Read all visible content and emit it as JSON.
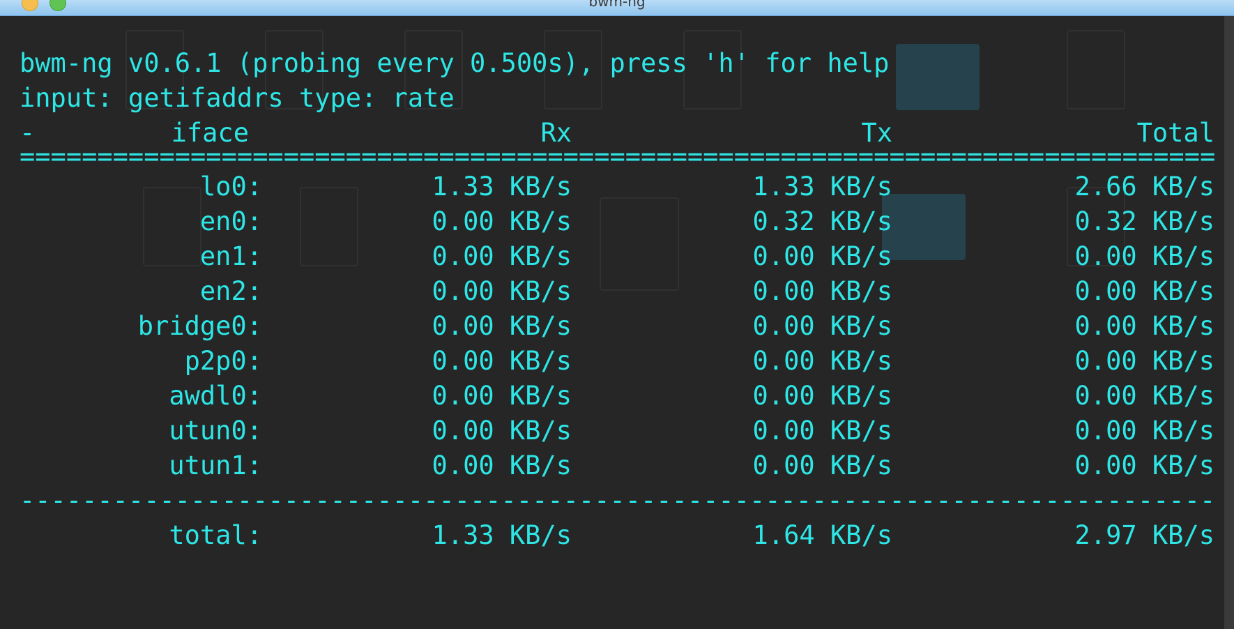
{
  "window": {
    "title": "bwm-ng"
  },
  "terminal": {
    "header_line": "bwm-ng v0.6.1 (probing every 0.500s), press 'h' for help",
    "input_line": "input: getifaddrs type: rate",
    "columns": {
      "dash": "-",
      "iface": "iface",
      "rx": "Rx",
      "tx": "Tx",
      "total": "Total"
    },
    "separator_top": "==============================================================================================================",
    "separator_bottom": "--------------------------------------------------------------------------------------------------------------",
    "rows": [
      {
        "iface": "lo0:",
        "rx": "1.33 KB/s",
        "tx": "1.33 KB/s",
        "total": "2.66 KB/s"
      },
      {
        "iface": "en0:",
        "rx": "0.00 KB/s",
        "tx": "0.32 KB/s",
        "total": "0.32 KB/s"
      },
      {
        "iface": "en1:",
        "rx": "0.00 KB/s",
        "tx": "0.00 KB/s",
        "total": "0.00 KB/s"
      },
      {
        "iface": "en2:",
        "rx": "0.00 KB/s",
        "tx": "0.00 KB/s",
        "total": "0.00 KB/s"
      },
      {
        "iface": "bridge0:",
        "rx": "0.00 KB/s",
        "tx": "0.00 KB/s",
        "total": "0.00 KB/s"
      },
      {
        "iface": "p2p0:",
        "rx": "0.00 KB/s",
        "tx": "0.00 KB/s",
        "total": "0.00 KB/s"
      },
      {
        "iface": "awdl0:",
        "rx": "0.00 KB/s",
        "tx": "0.00 KB/s",
        "total": "0.00 KB/s"
      },
      {
        "iface": "utun0:",
        "rx": "0.00 KB/s",
        "tx": "0.00 KB/s",
        "total": "0.00 KB/s"
      },
      {
        "iface": "utun1:",
        "rx": "0.00 KB/s",
        "tx": "0.00 KB/s",
        "total": "0.00 KB/s"
      }
    ],
    "total_row": {
      "iface": "total:",
      "rx": "1.33 KB/s",
      "tx": "1.64 KB/s",
      "total": "2.97 KB/s"
    }
  },
  "colors": {
    "terminal_text": "#2ee6e6",
    "terminal_bg": "#262626",
    "titlebar": "#8fc4ee"
  }
}
